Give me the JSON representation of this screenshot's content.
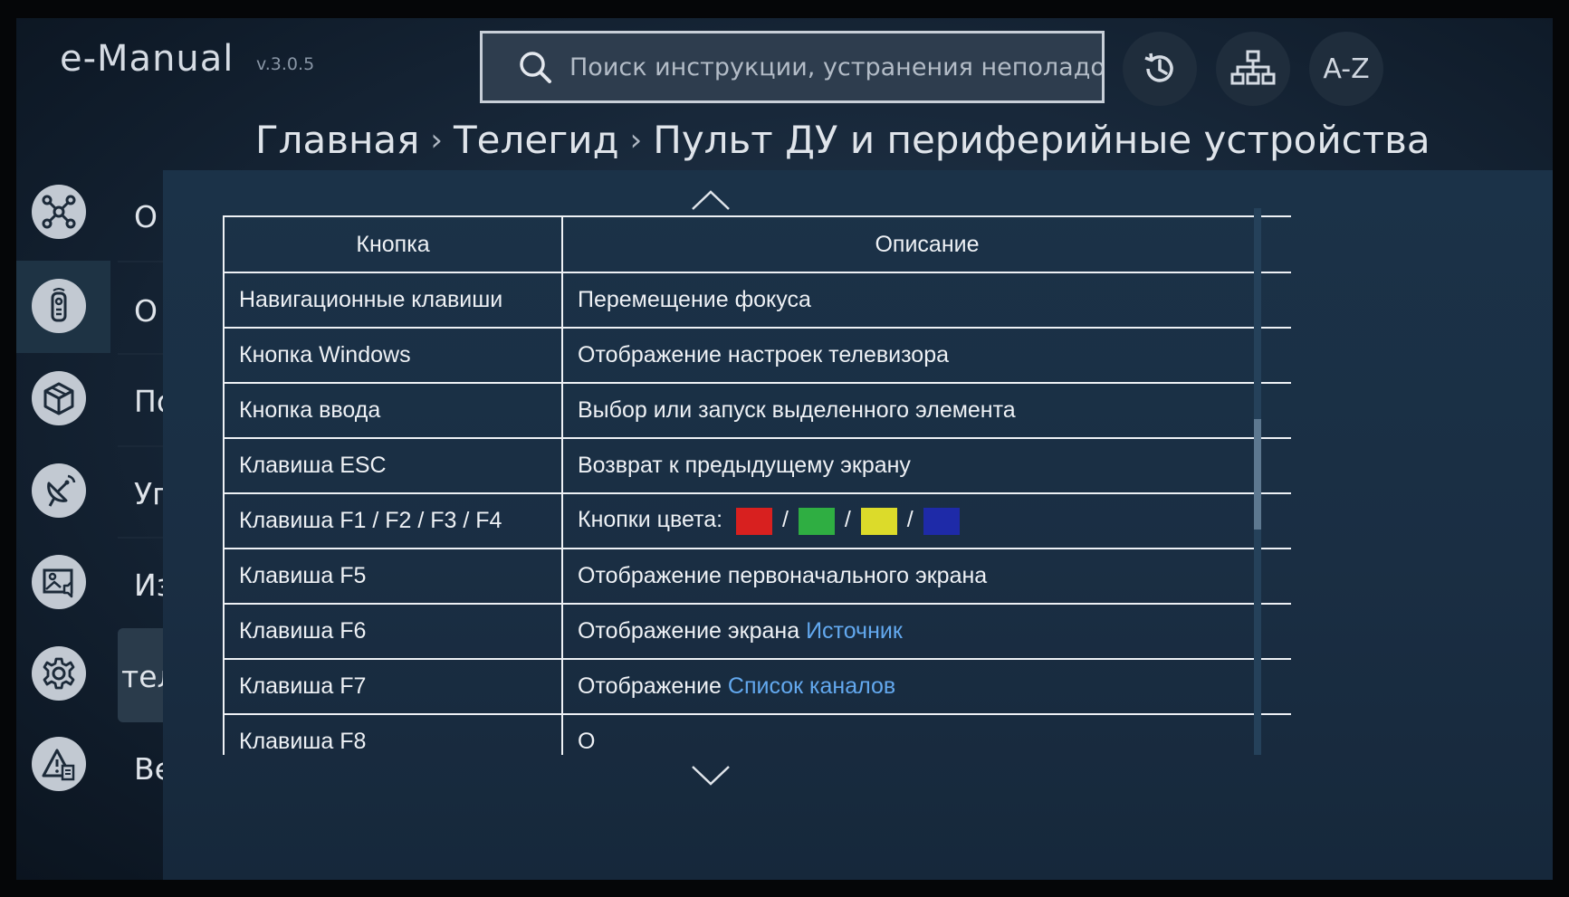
{
  "header": {
    "app_title": "e-Manual",
    "version": "v.3.0.5",
    "search_placeholder": "Поиск инструкции, устранения неполадок и р",
    "history_icon": "history-icon",
    "sitemap_icon": "sitemap-icon",
    "az_label": "A-Z"
  },
  "breadcrumb": {
    "items": [
      "Главная",
      "Телегид",
      "Пульт ДУ и периферийные устройства"
    ],
    "separator": "›"
  },
  "sidebar": {
    "items": [
      {
        "icon": "network-hub-icon",
        "label": "О"
      },
      {
        "icon": "remote-control-icon",
        "label": "О",
        "active": true
      },
      {
        "icon": "box-cube-icon",
        "label": "По"
      },
      {
        "icon": "satellite-dish-icon",
        "label": "Уг"
      },
      {
        "icon": "picture-sound-icon",
        "label": "Из"
      },
      {
        "icon": "gear-icon",
        "label": "тел",
        "highlighted": true
      },
      {
        "icon": "warning-document-icon",
        "label": "Ве"
      }
    ]
  },
  "table": {
    "headers": [
      "Кнопка",
      "Описание"
    ],
    "rows": [
      {
        "key": "Навигационные клавиши",
        "desc": "Перемещение фокуса"
      },
      {
        "key": "Кнопка Windows",
        "desc": "Отображение настроек телевизора"
      },
      {
        "key": "Кнопка ввода",
        "desc": "Выбор или запуск выделенного элемента"
      },
      {
        "key": "Клавиша ESC",
        "desc": "Возврат к предыдущему экрану"
      },
      {
        "key": "Клавиша F1 / F2 / F3 / F4",
        "desc": "Кнопки цвета:",
        "sep": "/"
      },
      {
        "key": "Клавиша F5",
        "desc": "Отображение первоначального экрана"
      },
      {
        "key": "Клавиша F6",
        "desc": "Отображение экрана",
        "link": "Источник"
      },
      {
        "key": "Клавиша F7",
        "desc": "Отображение",
        "link": "Список каналов"
      },
      {
        "key": "Клавиша F8",
        "desc": "О"
      }
    ]
  },
  "colors": {
    "red": "#d8201f",
    "green": "#2fae42",
    "yellow": "#dcdb2a",
    "blue": "#1e2aa8",
    "link": "#63a9ef"
  }
}
